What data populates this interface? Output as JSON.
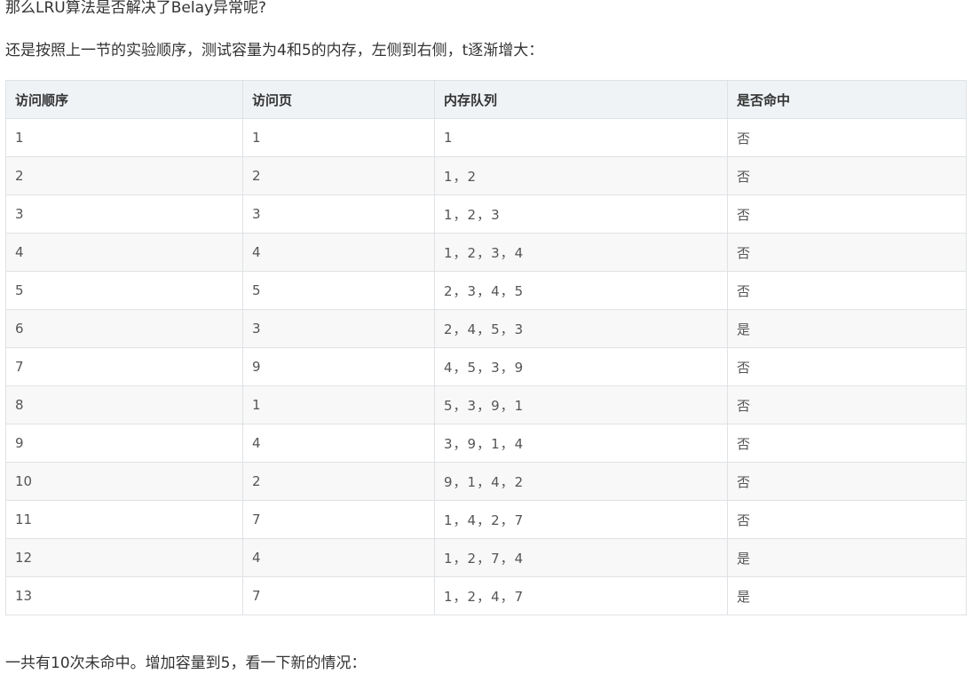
{
  "intro_question": "那么LRU算法是否解决了Belay异常呢?",
  "intro_description": "还是按照上一节的实验顺序，测试容量为4和5的内存，左侧到右侧，t逐渐增大：",
  "table": {
    "headers": [
      "访问顺序",
      "访问页",
      "内存队列",
      "是否命中"
    ],
    "rows": [
      [
        "1",
        "1",
        "1",
        "否"
      ],
      [
        "2",
        "2",
        "1，2",
        "否"
      ],
      [
        "3",
        "3",
        "1，2，3",
        "否"
      ],
      [
        "4",
        "4",
        "1，2，3，4",
        "否"
      ],
      [
        "5",
        "5",
        "2，3，4，5",
        "否"
      ],
      [
        "6",
        "3",
        "2，4，5，3",
        "是"
      ],
      [
        "7",
        "9",
        "4，5，3，9",
        "否"
      ],
      [
        "8",
        "1",
        "5，3，9，1",
        "否"
      ],
      [
        "9",
        "4",
        "3，9，1，4",
        "否"
      ],
      [
        "10",
        "2",
        "9，1，4，2",
        "否"
      ],
      [
        "11",
        "7",
        "1，4，2，7",
        "否"
      ],
      [
        "12",
        "4",
        "1，2，7，4",
        "是"
      ],
      [
        "13",
        "7",
        "1，2，4，7",
        "是"
      ]
    ]
  },
  "footer_text": "一共有10次未命中。增加容量到5，看一下新的情况："
}
